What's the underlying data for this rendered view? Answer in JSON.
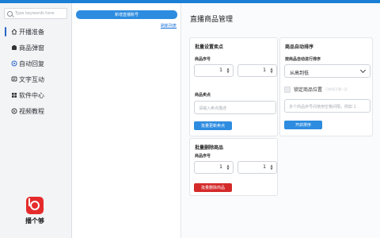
{
  "search": {
    "placeholder": "Type keywords here"
  },
  "nav": {
    "items": [
      {
        "icon": "home-icon",
        "label": "开播准备",
        "active": true
      },
      {
        "icon": "popup-icon",
        "label": "商品弹窗"
      },
      {
        "icon": "reply-icon",
        "label": "自动回复"
      },
      {
        "icon": "text-chat-icon",
        "label": "文字互动"
      },
      {
        "icon": "apps-icon",
        "label": "软件中心"
      },
      {
        "icon": "video-icon",
        "label": "视频教程"
      }
    ]
  },
  "logo": {
    "text": "播个够"
  },
  "accounts": {
    "add_label": "新增直播账号",
    "refresh_label": "刷新列表"
  },
  "main": {
    "title": "直播商品管理",
    "batch_selling": {
      "title": "批量设置卖点",
      "seq_label": "商品序号",
      "from": "1",
      "to": "1",
      "point_label": "商品卖点",
      "point_placeholder": "请输入卖点描述",
      "button": "批量更新卖点"
    },
    "auto_sort": {
      "title": "商品自动排序",
      "rule_label": "按商品自动进行排序",
      "rule_value": "从高到低",
      "lock_label": "锁定商品位置",
      "lock_hint": "只作用于第一页",
      "seq_placeholder": "多个商品序号间使用空格间隔，例如 1",
      "button": "开启排序"
    },
    "batch_delete": {
      "title": "批量删除商品",
      "seq_label": "商品序号",
      "from": "1",
      "to": "1",
      "button": "批量删除商品"
    }
  }
}
